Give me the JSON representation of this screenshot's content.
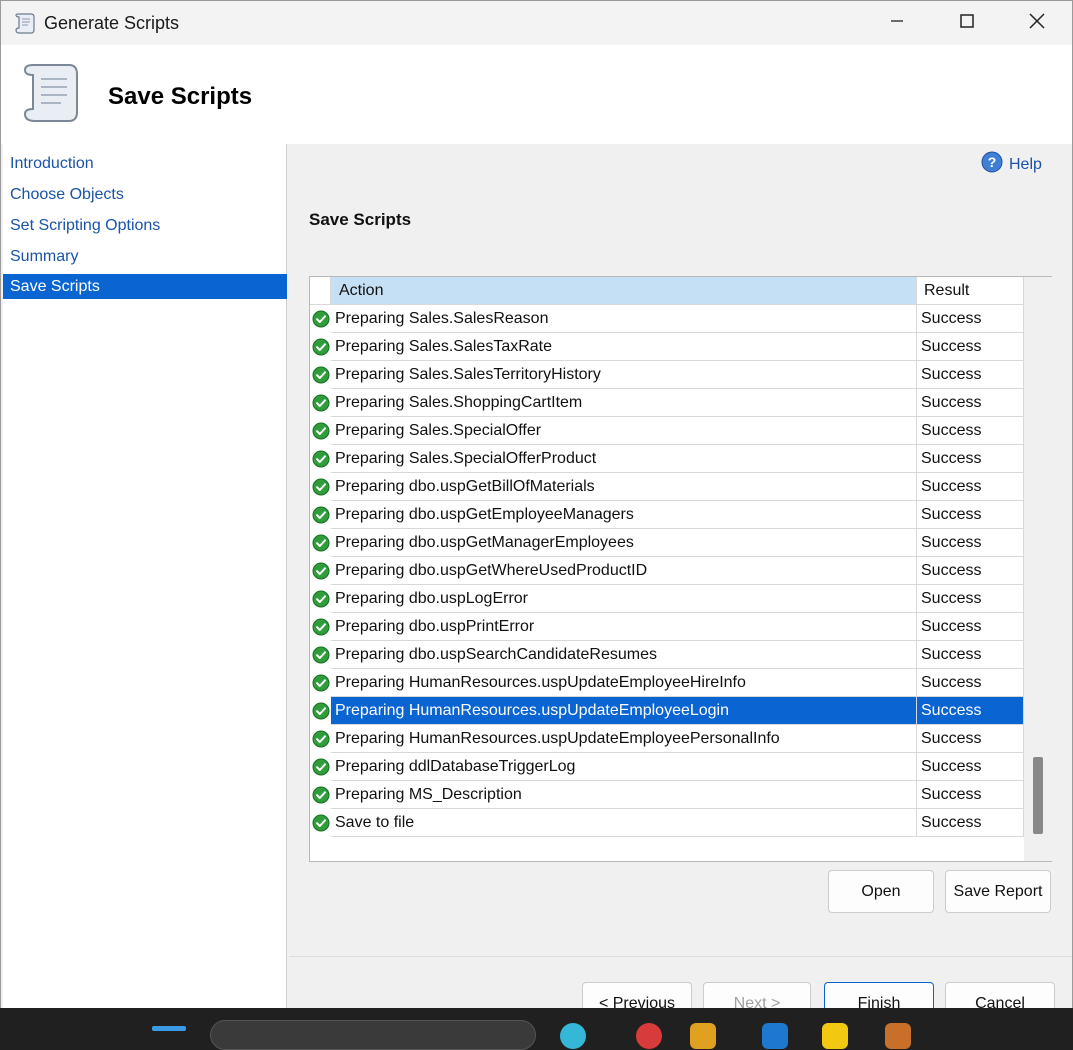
{
  "window": {
    "title": "Generate Scripts"
  },
  "header": {
    "title": "Save Scripts"
  },
  "nav": {
    "items": [
      {
        "label": "Introduction",
        "active": false
      },
      {
        "label": "Choose Objects",
        "active": false
      },
      {
        "label": "Set Scripting Options",
        "active": false
      },
      {
        "label": "Summary",
        "active": false
      },
      {
        "label": "Save Scripts",
        "active": true
      }
    ]
  },
  "main": {
    "help_label": "Help",
    "section_title": "Save Scripts",
    "grid": {
      "columns": [
        "Action",
        "Result"
      ],
      "rows": [
        {
          "action": "Preparing Sales.SalesReason",
          "result": "Success"
        },
        {
          "action": "Preparing Sales.SalesTaxRate",
          "result": "Success"
        },
        {
          "action": "Preparing Sales.SalesTerritoryHistory",
          "result": "Success"
        },
        {
          "action": "Preparing Sales.ShoppingCartItem",
          "result": "Success"
        },
        {
          "action": "Preparing Sales.SpecialOffer",
          "result": "Success"
        },
        {
          "action": "Preparing Sales.SpecialOfferProduct",
          "result": "Success"
        },
        {
          "action": "Preparing dbo.uspGetBillOfMaterials",
          "result": "Success"
        },
        {
          "action": "Preparing dbo.uspGetEmployeeManagers",
          "result": "Success"
        },
        {
          "action": "Preparing dbo.uspGetManagerEmployees",
          "result": "Success"
        },
        {
          "action": "Preparing dbo.uspGetWhereUsedProductID",
          "result": "Success"
        },
        {
          "action": "Preparing dbo.uspLogError",
          "result": "Success"
        },
        {
          "action": "Preparing dbo.uspPrintError",
          "result": "Success"
        },
        {
          "action": "Preparing dbo.uspSearchCandidateResumes",
          "result": "Success"
        },
        {
          "action": "Preparing HumanResources.uspUpdateEmployeeHireInfo",
          "result": "Success"
        },
        {
          "action": "Preparing HumanResources.uspUpdateEmployeeLogin",
          "result": "Success",
          "selected": true
        },
        {
          "action": "Preparing HumanResources.uspUpdateEmployeePersonalInfo",
          "result": "Success"
        },
        {
          "action": "Preparing ddlDatabaseTriggerLog",
          "result": "Success"
        },
        {
          "action": "Preparing MS_Description",
          "result": "Success"
        },
        {
          "action": "Save to file",
          "result": "Success"
        }
      ]
    },
    "open_label": "Open",
    "save_report_label": "Save Report"
  },
  "footer": {
    "previous_label": "< Previous",
    "next_label": "Next >",
    "finish_label": "Finish",
    "cancel_label": "Cancel"
  },
  "colors": {
    "accent": "#0a64d2",
    "link": "#1a53a8",
    "header_highlight": "#c5e0f5",
    "success_icon": "#2e9e3a"
  },
  "icons": {
    "title_icon": "scroll-icon",
    "header_icon": "scroll-icon",
    "help_icon": "help-circle-icon",
    "row_status_icon": "check-circle-icon"
  }
}
